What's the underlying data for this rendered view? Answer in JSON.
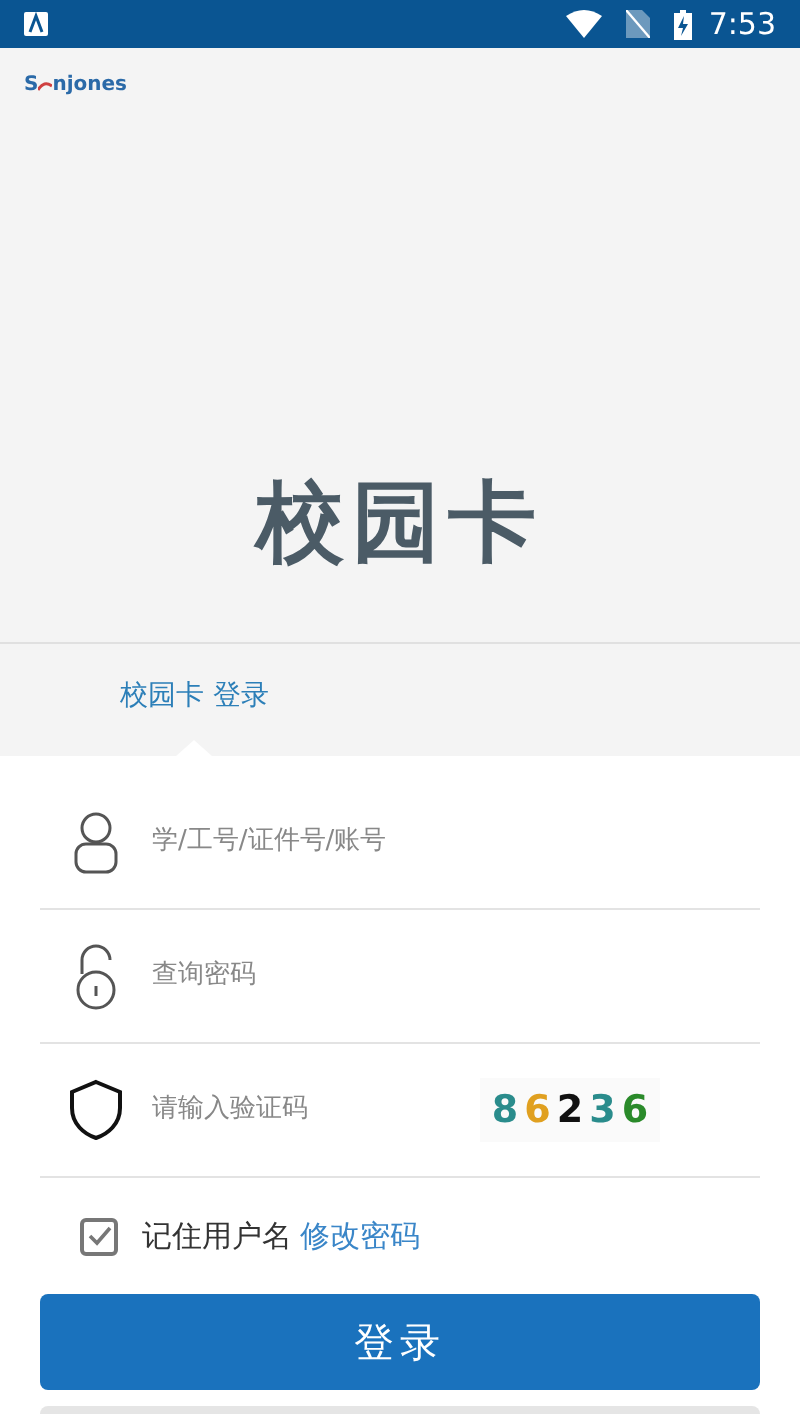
{
  "status_bar": {
    "time": "7:53"
  },
  "logo": {
    "left": "S",
    "right": "njones"
  },
  "title": "校园卡",
  "tabs": [
    {
      "label": "校园卡 登录",
      "selected": true
    }
  ],
  "fields": [
    {
      "kind": "user",
      "placeholder": "学/工号/证件号/账号"
    },
    {
      "kind": "lock",
      "placeholder": "查询密码"
    },
    {
      "kind": "shield",
      "placeholder": "请输入验证码",
      "captcha": [
        {
          "text": "8",
          "color": "#2a8c8c"
        },
        {
          "text": "6",
          "color": "#e0a020"
        },
        {
          "text": "2",
          "color": "#111111"
        },
        {
          "text": "3",
          "color": "#2a8c8c"
        },
        {
          "text": "6",
          "color": "#2a8a2a"
        }
      ]
    }
  ],
  "remember": {
    "label": "记住用户名",
    "checked": true
  },
  "change_password": "修改密码",
  "login_button": "登录"
}
